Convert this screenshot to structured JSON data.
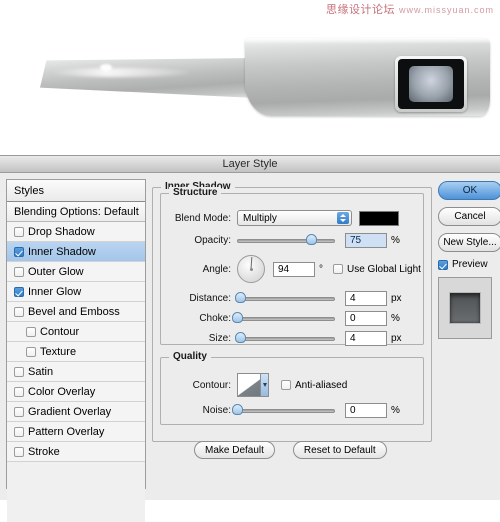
{
  "watermark": {
    "text": "思缘设计论坛",
    "url": "www.missyuan.com"
  },
  "photo": {
    "alt_name": "metallic-device-photo"
  },
  "dialog": {
    "title": "Layer Style",
    "styles_panel": {
      "header": "Styles",
      "blending_options": "Blending Options: Default",
      "items": [
        {
          "label": "Drop Shadow",
          "checked": false,
          "indent": false,
          "selected": false
        },
        {
          "label": "Inner Shadow",
          "checked": true,
          "indent": false,
          "selected": true
        },
        {
          "label": "Outer Glow",
          "checked": false,
          "indent": false,
          "selected": false
        },
        {
          "label": "Inner Glow",
          "checked": true,
          "indent": false,
          "selected": false
        },
        {
          "label": "Bevel and Emboss",
          "checked": false,
          "indent": false,
          "selected": false
        },
        {
          "label": "Contour",
          "checked": false,
          "indent": true,
          "selected": false
        },
        {
          "label": "Texture",
          "checked": false,
          "indent": true,
          "selected": false
        },
        {
          "label": "Satin",
          "checked": false,
          "indent": false,
          "selected": false
        },
        {
          "label": "Color Overlay",
          "checked": false,
          "indent": false,
          "selected": false
        },
        {
          "label": "Gradient Overlay",
          "checked": false,
          "indent": false,
          "selected": false
        },
        {
          "label": "Pattern Overlay",
          "checked": false,
          "indent": false,
          "selected": false
        },
        {
          "label": "Stroke",
          "checked": false,
          "indent": false,
          "selected": false
        }
      ]
    },
    "inner_shadow": {
      "group_title": "Inner Shadow",
      "structure": {
        "group_title": "Structure",
        "blend_mode_label": "Blend Mode:",
        "blend_mode_value": "Multiply",
        "color_swatch": "#000000",
        "opacity_label": "Opacity:",
        "opacity_value": "75",
        "opacity_unit": "%",
        "opacity_percent": 75,
        "angle_label": "Angle:",
        "angle_value": "94",
        "angle_unit": "°",
        "angle_degrees": 94,
        "use_global_light_label": "Use Global Light",
        "use_global_light_checked": false,
        "distance_label": "Distance:",
        "distance_value": "4",
        "distance_unit": "px",
        "distance_percent": 3,
        "choke_label": "Choke:",
        "choke_value": "0",
        "choke_unit": "%",
        "choke_percent": 0,
        "size_label": "Size:",
        "size_value": "4",
        "size_unit": "px",
        "size_percent": 3
      },
      "quality": {
        "group_title": "Quality",
        "contour_label": "Contour:",
        "anti_aliased_label": "Anti-aliased",
        "anti_aliased_checked": false,
        "noise_label": "Noise:",
        "noise_value": "0",
        "noise_unit": "%",
        "noise_percent": 0
      },
      "make_default_label": "Make Default",
      "reset_default_label": "Reset to Default"
    },
    "buttons": {
      "ok": "OK",
      "cancel": "Cancel",
      "new_style": "New Style...",
      "preview_label": "Preview",
      "preview_checked": true
    },
    "colors": {
      "accent": "#2f7dc8",
      "selection": "#a4c6ea",
      "dialog_bg": "#ececec"
    }
  }
}
